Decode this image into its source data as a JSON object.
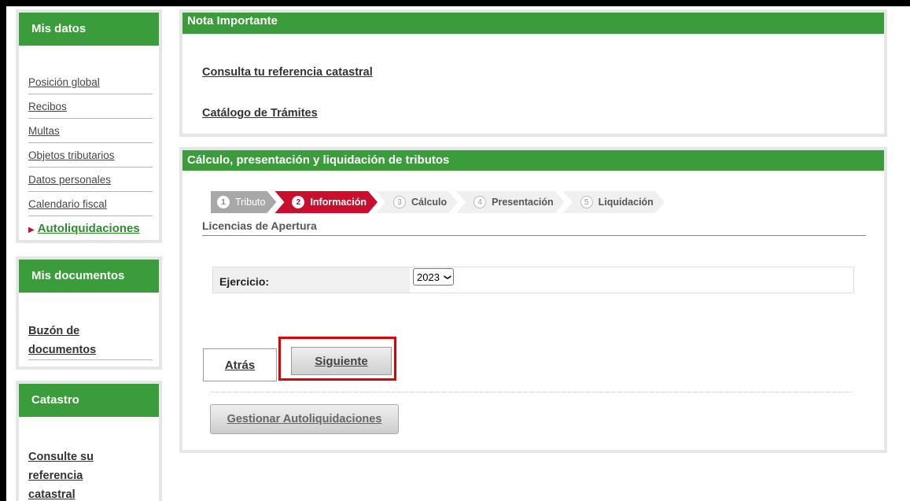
{
  "sidebar": {
    "mis_datos": {
      "title": "Mis datos",
      "items": [
        {
          "label": "Posición global"
        },
        {
          "label": "Recibos"
        },
        {
          "label": "Multas"
        },
        {
          "label": "Objetos tributarios"
        },
        {
          "label": "Datos personales"
        },
        {
          "label": "Calendario fiscal"
        },
        {
          "label": "Autoliquidaciones",
          "active": true
        }
      ]
    },
    "mis_documentos": {
      "title": "Mis documentos",
      "link_line1": "Buzón de",
      "link_line2": "documentos"
    },
    "catastro": {
      "title": "Catastro",
      "link_line1": "Consulte su",
      "link_line2": "referencia",
      "link_line3": "catastral"
    }
  },
  "nota": {
    "title": "Nota Importante",
    "link1": "Consulta tu referencia catastral",
    "link2": "Catálogo de Trámites"
  },
  "calculo": {
    "title": "Cálculo, presentación y liquidación de tributos",
    "steps": [
      {
        "num": "1",
        "label": "Tributo",
        "state": "done"
      },
      {
        "num": "2",
        "label": "Información",
        "state": "active"
      },
      {
        "num": "3",
        "label": "Cálculo",
        "state": "todo"
      },
      {
        "num": "4",
        "label": "Presentación",
        "state": "todo"
      },
      {
        "num": "5",
        "label": "Liquidación",
        "state": "todo"
      }
    ],
    "subtitle": "Licencias de Apertura",
    "field_label": "Ejercicio:",
    "field_value": "2023",
    "back_label": "Atrás",
    "next_label": "Siguiente",
    "manage_label": "Gestionar Autoliquidaciones"
  },
  "colors": {
    "header_green": "#3a9c3a",
    "active_red": "#c8102e",
    "highlight_red": "#e00000"
  }
}
